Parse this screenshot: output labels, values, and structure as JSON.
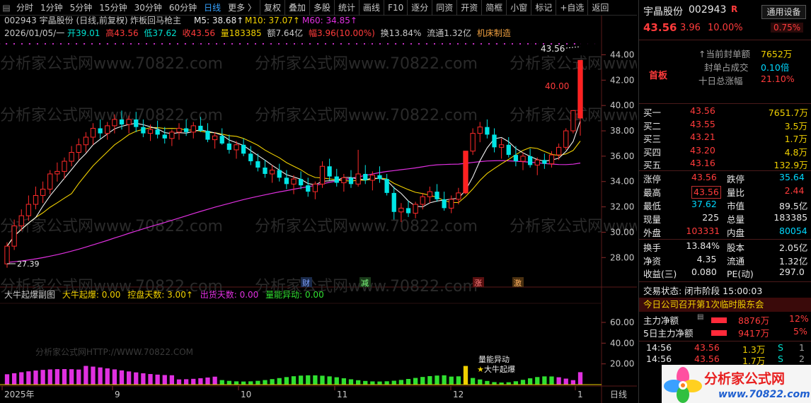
{
  "toolbar": {
    "items": [
      "分时",
      "1分钟",
      "5分钟",
      "15分钟",
      "30分钟",
      "60分钟",
      "日线",
      "更多 〉",
      "复权",
      "叠加",
      "多股",
      "统计",
      "画线",
      "F10",
      "逐分",
      "同资",
      "开资",
      "简框",
      "小窗",
      "标记",
      "+自选",
      "返回"
    ],
    "active": "日线"
  },
  "header": {
    "stock_title": "002943 宇晶股份 (日线,前复权)",
    "indicator_name": "炸板回马枪主",
    "ma5_label": "M5: 38.68↑",
    "ma10_label": "M10: 37.07↑",
    "ma60_label": "M60: 34.85↑",
    "ohlc_line": {
      "date": "2026/01/05/一",
      "open": "开39.01",
      "high": "高43.56",
      "low": "低37.62",
      "close": "收43.56",
      "volume": "量183385",
      "amount": "额7.64亿",
      "change": "幅3.96(10.00%)",
      "turnover": "换13.84%",
      "float": "流通1.32亿",
      "industry": "机床制造"
    }
  },
  "watermark": "分析家公式网www.70822.com",
  "sub_watermark": "分析家公式网HTTP://WWW.70822.COM",
  "price_axis": [
    "44.00",
    "42.00",
    "40.00",
    "38.00",
    "36.00",
    "34.00",
    "32.00",
    "30.00",
    "28.00"
  ],
  "price_annotations": {
    "high": "43.56",
    "low": "27.39",
    "mid": "40.00"
  },
  "event_tags": [
    "财",
    "减",
    "涨",
    "激"
  ],
  "sub_header": {
    "name": "大牛起爆副图",
    "a": "大牛起爆: 0.00",
    "b": "控盘天数: 3.00↑",
    "c": "出货天数: 0.00",
    "d": "量能异动: 0.00"
  },
  "sub_axis": [
    "60.00",
    "40.00",
    "20.00"
  ],
  "sub_annotations": [
    "量能异动",
    "大牛起爆"
  ],
  "x_axis": [
    "2025年",
    "9",
    "10",
    "11",
    "12",
    "1"
  ],
  "period_label": "日线",
  "chart_data": {
    "type": "candlestick",
    "ylim": [
      26.5,
      45
    ],
    "candles": [
      [
        27.5,
        29.2,
        27.2,
        28.9
      ],
      [
        28.9,
        31.0,
        28.6,
        30.5
      ],
      [
        30.5,
        31.8,
        30.1,
        31.3
      ],
      [
        31.3,
        32.9,
        30.9,
        32.2
      ],
      [
        32.2,
        33.6,
        31.8,
        32.9
      ],
      [
        32.9,
        34.0,
        32.3,
        33.4
      ],
      [
        33.4,
        34.9,
        33.0,
        34.6
      ],
      [
        34.6,
        35.5,
        34.0,
        34.8
      ],
      [
        34.8,
        35.9,
        34.2,
        35.6
      ],
      [
        35.6,
        36.8,
        35.2,
        36.3
      ],
      [
        36.3,
        37.4,
        35.7,
        36.9
      ],
      [
        36.9,
        37.9,
        36.3,
        37.5
      ],
      [
        37.5,
        38.6,
        36.9,
        38.2
      ],
      [
        38.2,
        38.9,
        37.4,
        37.8
      ],
      [
        37.8,
        38.7,
        37.3,
        38.4
      ],
      [
        38.4,
        39.3,
        37.8,
        38.9
      ],
      [
        38.9,
        39.6,
        38.1,
        38.5
      ],
      [
        38.5,
        39.2,
        37.8,
        38.9
      ],
      [
        38.9,
        39.5,
        37.9,
        38.3
      ],
      [
        38.3,
        38.9,
        37.5,
        37.8
      ],
      [
        37.8,
        38.5,
        37.2,
        38.1
      ],
      [
        38.1,
        38.8,
        37.4,
        37.7
      ],
      [
        37.7,
        38.3,
        37.0,
        37.4
      ],
      [
        37.4,
        38.1,
        36.8,
        37.9
      ],
      [
        37.9,
        38.6,
        37.3,
        38.2
      ],
      [
        38.2,
        38.9,
        37.6,
        37.9
      ],
      [
        37.9,
        38.7,
        37.4,
        38.4
      ],
      [
        38.4,
        39.1,
        37.9,
        38.0
      ],
      [
        38.0,
        38.6,
        37.1,
        37.3
      ],
      [
        37.3,
        37.9,
        36.6,
        37.6
      ],
      [
        37.6,
        38.2,
        36.9,
        37.0
      ],
      [
        37.0,
        37.7,
        36.2,
        36.5
      ],
      [
        36.5,
        37.2,
        35.8,
        36.9
      ],
      [
        36.9,
        37.4,
        36.0,
        36.2
      ],
      [
        36.2,
        36.8,
        35.3,
        35.6
      ],
      [
        35.6,
        36.2,
        34.8,
        35.1
      ],
      [
        35.1,
        35.7,
        34.3,
        34.6
      ],
      [
        34.6,
        35.3,
        33.9,
        34.9
      ],
      [
        34.9,
        35.4,
        34.0,
        34.3
      ],
      [
        34.3,
        34.9,
        33.4,
        33.8
      ],
      [
        33.8,
        34.5,
        33.0,
        34.2
      ],
      [
        34.2,
        34.8,
        33.4,
        33.7
      ],
      [
        33.7,
        34.3,
        32.8,
        33.2
      ],
      [
        33.2,
        34.0,
        32.6,
        33.8
      ],
      [
        33.8,
        35.6,
        33.5,
        35.2
      ],
      [
        35.2,
        35.8,
        34.1,
        34.4
      ],
      [
        34.4,
        35.0,
        33.6,
        33.9
      ],
      [
        33.9,
        34.6,
        33.2,
        34.3
      ],
      [
        34.3,
        34.9,
        33.5,
        33.8
      ],
      [
        33.8,
        36.5,
        33.6,
        34.6
      ],
      [
        34.6,
        35.3,
        33.8,
        34.1
      ],
      [
        34.1,
        34.8,
        33.3,
        34.5
      ],
      [
        34.5,
        35.2,
        33.9,
        34.2
      ],
      [
        34.2,
        34.6,
        32.9,
        33.1
      ],
      [
        33.1,
        33.6,
        31.0,
        31.6
      ],
      [
        31.6,
        32.3,
        30.8,
        31.9
      ],
      [
        31.9,
        32.5,
        31.2,
        31.5
      ],
      [
        31.5,
        32.4,
        31.1,
        32.2
      ],
      [
        32.2,
        33.1,
        31.8,
        32.8
      ],
      [
        32.8,
        33.6,
        32.3,
        33.2
      ],
      [
        33.2,
        33.8,
        32.4,
        32.6
      ],
      [
        32.6,
        33.2,
        31.7,
        31.9
      ],
      [
        31.9,
        32.9,
        31.5,
        32.6
      ],
      [
        32.6,
        33.5,
        32.2,
        33.1
      ],
      [
        33.1,
        36.4,
        33.0,
        36.4
      ],
      [
        36.4,
        38.2,
        36.1,
        37.8
      ],
      [
        37.8,
        38.7,
        37.1,
        38.3
      ],
      [
        38.3,
        38.9,
        37.4,
        37.7
      ],
      [
        37.7,
        38.2,
        36.3,
        36.7
      ],
      [
        36.7,
        37.4,
        35.8,
        36.9
      ],
      [
        36.9,
        37.5,
        35.9,
        36.1
      ],
      [
        36.1,
        36.8,
        35.2,
        35.6
      ],
      [
        35.6,
        36.3,
        34.9,
        36.0
      ],
      [
        36.0,
        36.6,
        35.1,
        35.3
      ],
      [
        35.3,
        35.9,
        34.5,
        35.7
      ],
      [
        35.7,
        36.2,
        35.0,
        35.4
      ],
      [
        35.4,
        36.4,
        35.1,
        36.1
      ],
      [
        36.1,
        37.0,
        35.7,
        36.7
      ],
      [
        36.7,
        38.2,
        36.5,
        38.0
      ],
      [
        38.0,
        39.6,
        37.8,
        39.6
      ],
      [
        39.01,
        43.56,
        37.62,
        43.56
      ]
    ],
    "ma5_end": 38.68,
    "ma10_end": 37.07,
    "ma60_end": 34.85,
    "volume_pattern": "magenta early, green mid, red late"
  },
  "quote": {
    "name": "宇晶股份",
    "code": "002943",
    "flag": "R",
    "price": "43.56",
    "change": "3.96",
    "pct": "10.00%",
    "setting_btn": "通用设备",
    "setting_pct": "0.75%",
    "limit_label": "首板",
    "seal_rows": [
      {
        "label": "当前封单额",
        "value": "7652万"
      },
      {
        "label": "封单占成交",
        "value": "0.10倍"
      },
      {
        "label": "十日总涨幅",
        "value": "21.10%"
      }
    ],
    "book": [
      {
        "label": "买一",
        "price": "43.56",
        "vol": "7651.7万"
      },
      {
        "label": "买二",
        "price": "43.55",
        "vol": "3.5万"
      },
      {
        "label": "买三",
        "price": "43.21",
        "vol": "1.7万"
      },
      {
        "label": "买四",
        "price": "43.20",
        "vol": "4.8万"
      },
      {
        "label": "买五",
        "price": "43.16",
        "vol": "132.9万"
      }
    ],
    "stats": [
      [
        "涨停",
        "43.56",
        "跌停",
        "35.64"
      ],
      [
        "最高",
        "43.56",
        "量比",
        "2.44"
      ],
      [
        "最低",
        "37.62",
        "市值",
        "89.5亿"
      ],
      [
        "现量",
        "225",
        "总量",
        "183385"
      ],
      [
        "外盘",
        "103331",
        "内盘",
        "80054"
      ]
    ],
    "stats2": [
      [
        "换手",
        "13.84%",
        "股本",
        "2.05亿"
      ],
      [
        "净资",
        "4.35",
        "流通",
        "1.32亿"
      ],
      [
        "收益(三)",
        "0.080",
        "PE(动)",
        "297.0"
      ]
    ],
    "status": "交易状态: 闭市阶段 15:00:03",
    "notice": "今日公司召开第1次临时股东会",
    "flows": [
      {
        "label": "主力净额",
        "value": "8876万",
        "pct": "12%"
      },
      {
        "label": "5日主力净额",
        "value": "9417万",
        "pct": "5%"
      }
    ],
    "ticks": [
      {
        "time": "14:56",
        "price": "43.56",
        "vol": "1.3万",
        "side": "S",
        "n": "1"
      },
      {
        "time": "14:56",
        "price": "43.56",
        "vol": "1.7万",
        "side": "S",
        "n": "2"
      }
    ],
    "logo_text": "分析家公式网",
    "logo_url": "www.70822.com"
  }
}
